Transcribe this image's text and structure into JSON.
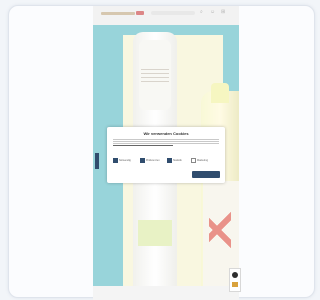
{
  "topbar": {
    "title": "",
    "search_icon": "search-icon",
    "user_icon": "user-icon",
    "cart_icon": "cart-icon"
  },
  "cookie_dialog": {
    "heading": "Wir verwenden Cookies",
    "subheading": "",
    "options": [
      {
        "label": "Notwendig",
        "checked": true
      },
      {
        "label": "Präferenzen",
        "checked": true
      },
      {
        "label": "Statistik",
        "checked": true
      },
      {
        "label": "Marketing",
        "checked": false
      }
    ],
    "details_label": "",
    "save_label": "",
    "accept_label": ""
  },
  "bottom_nav": {
    "items": [
      "",
      "",
      "",
      "",
      ""
    ]
  },
  "colors": {
    "background": "#f2f5f9",
    "teal": "#4bb3bf",
    "accent_navy": "#304d6e",
    "badge_red": "#c12b2b"
  }
}
